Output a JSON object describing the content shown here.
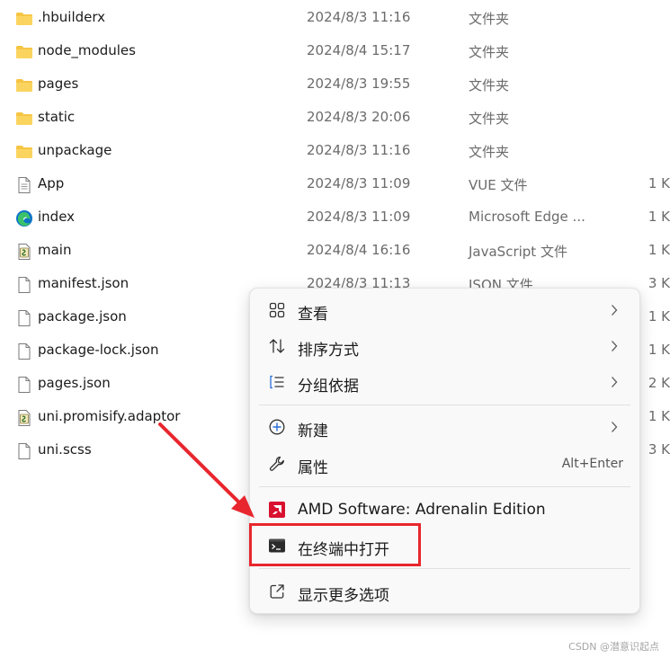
{
  "files": [
    {
      "name": ".hbuilderx",
      "date": "2024/8/3 11:16",
      "type": "文件夹",
      "size": "",
      "icon": "folder-icon"
    },
    {
      "name": "node_modules",
      "date": "2024/8/4 15:17",
      "type": "文件夹",
      "size": "",
      "icon": "folder-icon"
    },
    {
      "name": "pages",
      "date": "2024/8/3 19:55",
      "type": "文件夹",
      "size": "",
      "icon": "folder-icon"
    },
    {
      "name": "static",
      "date": "2024/8/3 20:06",
      "type": "文件夹",
      "size": "",
      "icon": "folder-icon"
    },
    {
      "name": "unpackage",
      "date": "2024/8/3 11:16",
      "type": "文件夹",
      "size": "",
      "icon": "folder-icon"
    },
    {
      "name": "App",
      "date": "2024/8/3 11:09",
      "type": "VUE 文件",
      "size": "1 K",
      "icon": "text-file-icon"
    },
    {
      "name": "index",
      "date": "2024/8/3 11:09",
      "type": "Microsoft Edge ...",
      "size": "1 K",
      "icon": "edge-icon"
    },
    {
      "name": "main",
      "date": "2024/8/4 16:16",
      "type": "JavaScript 文件",
      "size": "1 K",
      "icon": "script-file-icon"
    },
    {
      "name": "manifest.json",
      "date": "2024/8/3 11:13",
      "type": "JSON 文件",
      "size": "3 K",
      "icon": "blank-file-icon"
    },
    {
      "name": "package.json",
      "date": "",
      "type": "",
      "size": "1 K",
      "icon": "blank-file-icon"
    },
    {
      "name": "package-lock.json",
      "date": "",
      "type": "",
      "size": "1 K",
      "icon": "blank-file-icon"
    },
    {
      "name": "pages.json",
      "date": "",
      "type": "",
      "size": "2 K",
      "icon": "blank-file-icon"
    },
    {
      "name": "uni.promisify.adaptor",
      "date": "",
      "type": "",
      "size": "1 K",
      "icon": "script-file-icon"
    },
    {
      "name": "uni.scss",
      "date": "",
      "type": "",
      "size": "3 K",
      "icon": "blank-file-icon"
    }
  ],
  "context_menu": {
    "view": "查看",
    "sort": "排序方式",
    "group": "分组依据",
    "new": "新建",
    "properties": "属性",
    "properties_shortcut": "Alt+Enter",
    "amd": "AMD Software: Adrenalin Edition",
    "terminal": "在终端中打开",
    "more": "显示更多选项"
  },
  "watermark": "CSDN @潜意识起点",
  "colors": {
    "folder": "#f6c544",
    "highlight": "#e8262d",
    "amd": "#d9112f",
    "edge_blue": "#0c73c9",
    "edge_green": "#3cc26a"
  }
}
